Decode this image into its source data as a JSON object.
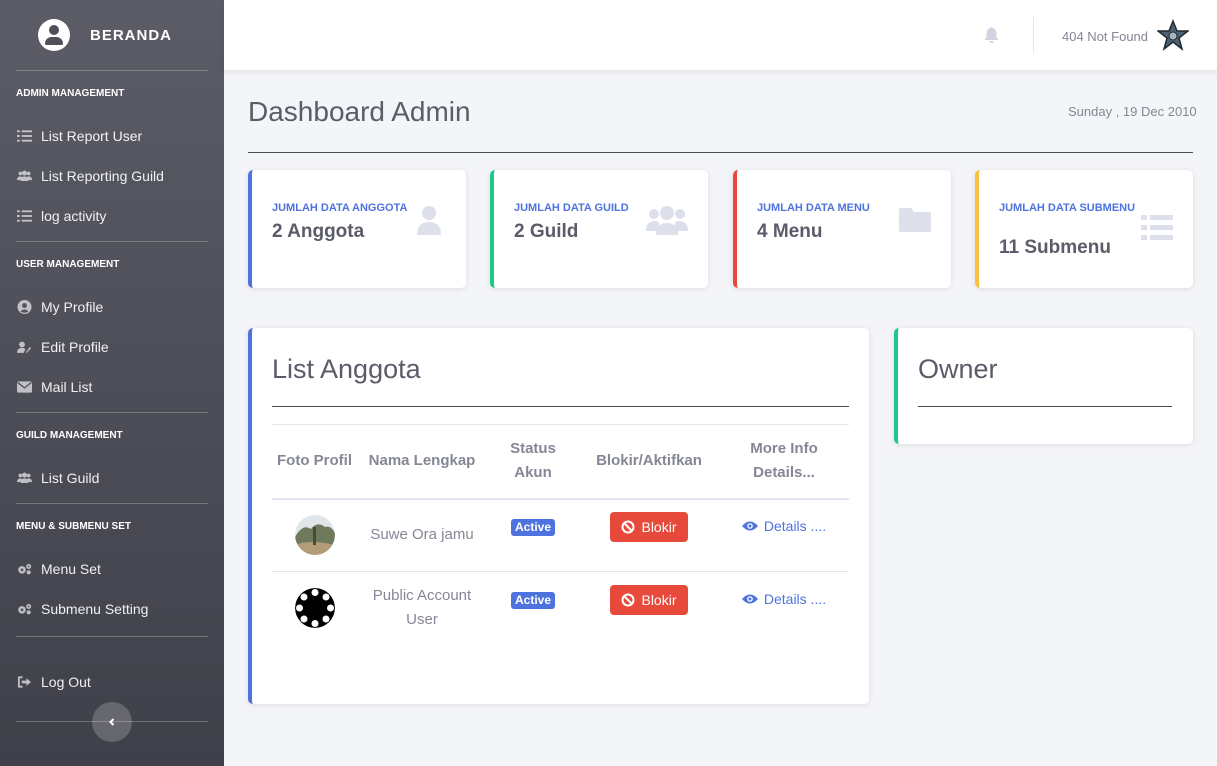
{
  "sidebar": {
    "brand": "BERANDA",
    "sections": [
      {
        "heading": "ADMIN MANAGEMENT",
        "items": [
          {
            "label": "List Report User",
            "icon": "list-icon"
          },
          {
            "label": "List Reporting Guild",
            "icon": "users-icon"
          },
          {
            "label": "log activity",
            "icon": "list-icon"
          }
        ]
      },
      {
        "heading": "USER MANAGEMENT",
        "items": [
          {
            "label": "My Profile",
            "icon": "user-circle-icon"
          },
          {
            "label": "Edit Profile",
            "icon": "user-edit-icon"
          },
          {
            "label": "Mail List",
            "icon": "envelope-icon"
          }
        ]
      },
      {
        "heading": "GUILD MANAGEMENT",
        "items": [
          {
            "label": "List Guild",
            "icon": "users-icon"
          }
        ]
      },
      {
        "heading": "MENU & SUBMENU SET",
        "items": [
          {
            "label": "Menu Set",
            "icon": "cogs-icon"
          },
          {
            "label": "Submenu Setting",
            "icon": "cogs-icon"
          }
        ]
      }
    ],
    "logout": "Log Out"
  },
  "topbar": {
    "user_name": "404 Not Found"
  },
  "page": {
    "title": "Dashboard Admin",
    "date": "Sunday , 19 Dec 2010"
  },
  "stats": [
    {
      "label": "JUMLAH DATA ANGGOTA",
      "value": "2 Anggota",
      "icon": "user-icon",
      "color": "#4e73df"
    },
    {
      "label": "JUMLAH DATA GUILD",
      "value": "2 Guild",
      "icon": "users-icon",
      "color": "#1cc88a"
    },
    {
      "label": "JUMLAH DATA MENU",
      "value": "4 Menu",
      "icon": "folder-icon",
      "color": "#e74a3b"
    },
    {
      "label": "JUMLAH DATA SUBMENU",
      "value": "11 Submenu",
      "icon": "list-icon",
      "color": "#f6c23e"
    }
  ],
  "members": {
    "title": "List Anggota",
    "columns": [
      "Foto Profil",
      "Nama Lengkap",
      "Status Akun",
      "Blokir/Aktifkan",
      "More Info Details..."
    ],
    "rows": [
      {
        "name": "Suwe Ora jamu",
        "status": "Active",
        "action": "Blokir",
        "details": "Details ...."
      },
      {
        "name": "Public Account User",
        "status": "Active",
        "action": "Blokir",
        "details": "Details ...."
      }
    ]
  },
  "owner": {
    "title": "Owner"
  },
  "colors": {
    "primary": "#4e73df",
    "success": "#1cc88a",
    "danger": "#e74a3b",
    "warning": "#f6c23e"
  }
}
